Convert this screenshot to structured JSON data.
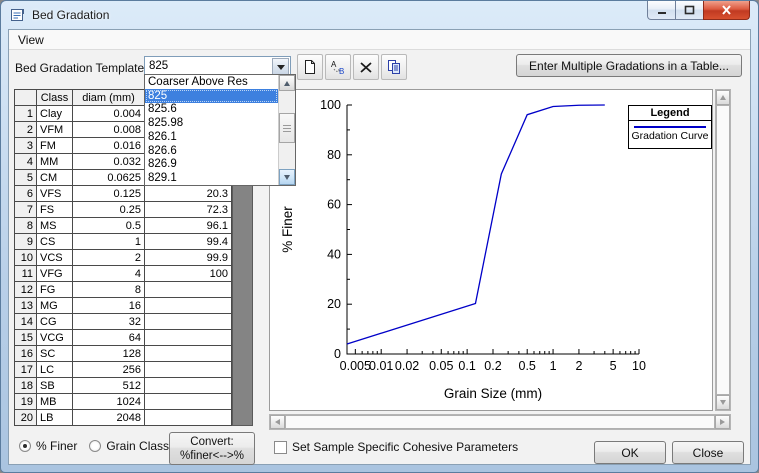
{
  "window": {
    "title": "Bed Gradation"
  },
  "menu_bar": {
    "items": [
      "View"
    ]
  },
  "template_bar": {
    "label": "Bed Gradation Template:",
    "combo_value": "825",
    "toolbar_icons": [
      "new-document-icon",
      "rename-icon",
      "delete-icon",
      "copy-icon"
    ],
    "enter_multiple_label": "Enter Multiple Gradations in a Table..."
  },
  "template_dropdown": {
    "items": [
      "Coarser Above Res",
      "825",
      "825.6",
      "825.98",
      "826.1",
      "826.6",
      "826.9",
      "829.1"
    ],
    "selected": "825"
  },
  "grain_table": {
    "headers": [
      "",
      "Class",
      "diam (mm)",
      ""
    ],
    "rows": [
      [
        "1",
        "Clay",
        "0.004",
        ""
      ],
      [
        "2",
        "VFM",
        "0.008",
        ""
      ],
      [
        "3",
        "FM",
        "0.016",
        ""
      ],
      [
        "4",
        "MM",
        "0.032",
        ""
      ],
      [
        "5",
        "CM",
        "0.0625",
        ""
      ],
      [
        "6",
        "VFS",
        "0.125",
        "20.3"
      ],
      [
        "7",
        "FS",
        "0.25",
        "72.3"
      ],
      [
        "8",
        "MS",
        "0.5",
        "96.1"
      ],
      [
        "9",
        "CS",
        "1",
        "99.4"
      ],
      [
        "10",
        "VCS",
        "2",
        "99.9"
      ],
      [
        "11",
        "VFG",
        "4",
        "100"
      ],
      [
        "12",
        "FG",
        "8",
        ""
      ],
      [
        "13",
        "MG",
        "16",
        ""
      ],
      [
        "14",
        "CG",
        "32",
        ""
      ],
      [
        "15",
        "VCG",
        "64",
        ""
      ],
      [
        "16",
        "SC",
        "128",
        ""
      ],
      [
        "17",
        "LC",
        "256",
        ""
      ],
      [
        "18",
        "SB",
        "512",
        ""
      ],
      [
        "19",
        "MB",
        "1024",
        ""
      ],
      [
        "20",
        "LB",
        "2048",
        ""
      ]
    ]
  },
  "chart_data": {
    "type": "line",
    "x_scale": "log",
    "xlabel": "Grain Size (mm)",
    "ylabel": "% Finer",
    "xlim": [
      0.004,
      10
    ],
    "ylim": [
      0,
      100
    ],
    "x_ticks": [
      0.005,
      0.01,
      0.02,
      0.05,
      0.1,
      0.2,
      0.5,
      1,
      2,
      5,
      10
    ],
    "x_tick_labels": [
      "0.005",
      "0.01",
      "0.02",
      "0.05",
      "0.1",
      "0.2",
      "0.5",
      "1",
      "2",
      "5",
      "10"
    ],
    "y_ticks": [
      0,
      20,
      40,
      60,
      80,
      100
    ],
    "y_tick_labels": [
      "0",
      "20",
      "40",
      "60",
      "80",
      "100"
    ],
    "grid": false,
    "legend": {
      "title": "Legend",
      "position": "top-right",
      "entries": [
        {
          "label": "Gradation Curve",
          "color": "#0000c8"
        }
      ]
    },
    "series": [
      {
        "name": "Gradation Curve",
        "color": "#0000c8",
        "points": [
          [
            0.004,
            4
          ],
          [
            0.125,
            20.3
          ],
          [
            0.25,
            72.3
          ],
          [
            0.5,
            96.1
          ],
          [
            1,
            99.4
          ],
          [
            2,
            99.9
          ],
          [
            4,
            100
          ]
        ]
      }
    ]
  },
  "footer": {
    "radios": [
      {
        "label": "% Finer",
        "selected": true
      },
      {
        "label": "Grain Class %",
        "selected": false
      }
    ],
    "convert_button": {
      "line1": "Convert:",
      "line2": "%finer<-->%"
    },
    "checkbox": {
      "label": "Set Sample Specific Cohesive Parameters",
      "checked": false
    },
    "ok_label": "OK",
    "close_label": "Close"
  },
  "colors": {
    "curve": "#0000c8",
    "selection_bg": "#3d80df",
    "titlebar": "#c6d9ee",
    "table_strip": "#848484"
  }
}
